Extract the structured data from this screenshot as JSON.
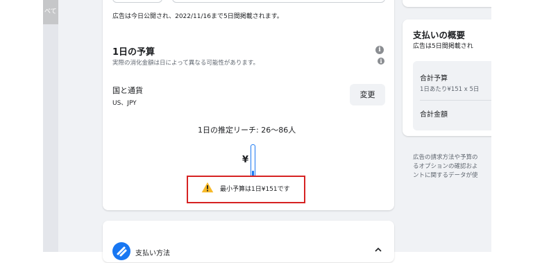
{
  "left_panel": {
    "tab_text": "べて"
  },
  "budget": {
    "publish_note": "広告は今日公開され、2022/11/16まで5日間掲載されます。",
    "daily_title": "1日の予算",
    "daily_subtitle": "実際の消化金額は日によって異なる可能性があります。",
    "country_label": "国と通貨",
    "country_value": "US、JPY",
    "change_button": "変更",
    "reach_label": "1日の推定リーチ: 26〜86人",
    "currency_symbol": "¥",
    "warning_text": "最小予算は1日¥151です",
    "slider_level": 0.0
  },
  "summary": {
    "title": "支払いの概要",
    "subtitle": "広告は5日間掲載され",
    "total_budget_label": "合計予算",
    "total_budget_detail": "1日あたり¥151 x 5日",
    "total_amount_label": "合計金額",
    "footer_text_1": "広告の請求方法や予算の",
    "footer_text_2": "るオプションの確認およ",
    "footer_text_3": "ントに関するデータが使"
  },
  "payment": {
    "title": "支払い方法"
  },
  "icons": {
    "info": "info-icon",
    "warning": "warning-icon",
    "payment": "payment-method-icon",
    "chevron": "chevron-up-icon"
  },
  "colors": {
    "accent": "#1877f2",
    "warning_border": "#d62222",
    "warning_icon": "#f7b928"
  }
}
